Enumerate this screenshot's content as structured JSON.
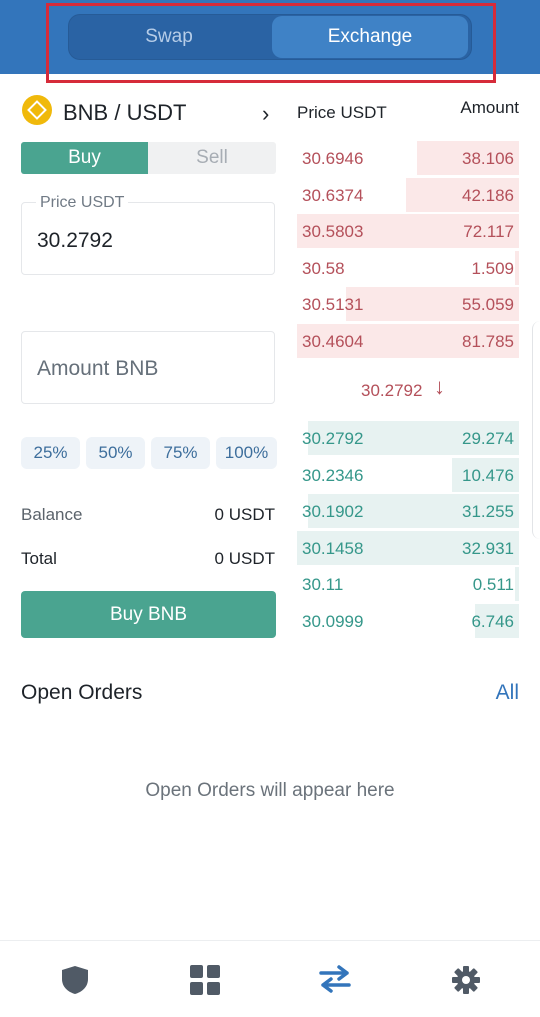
{
  "header": {
    "tabs": [
      "Swap",
      "Exchange"
    ],
    "active_tab": "Exchange"
  },
  "pair": {
    "label": "BNB / USDT",
    "base": "BNB",
    "quote": "USDT",
    "icon": "bnb-coin-icon"
  },
  "side_toggle": {
    "buy": "Buy",
    "sell": "Sell",
    "active": "Buy"
  },
  "price_field": {
    "label": "Price USDT",
    "value": "30.2792"
  },
  "amount_field": {
    "placeholder": "Amount BNB"
  },
  "percent_buttons": [
    "25%",
    "50%",
    "75%",
    "100%"
  ],
  "balance": {
    "label": "Balance",
    "value": "0 USDT"
  },
  "total": {
    "label": "Total",
    "value": "0 USDT"
  },
  "buy_button": "Buy BNB",
  "orderbook": {
    "price_header": "Price USDT",
    "amount_header": "Amount",
    "asks": [
      {
        "price": "30.6946",
        "amount": "38.106",
        "depth": 0.46
      },
      {
        "price": "30.6374",
        "amount": "42.186",
        "depth": 0.51
      },
      {
        "price": "30.5803",
        "amount": "72.117",
        "depth": 1.0
      },
      {
        "price": "30.58",
        "amount": "1.509",
        "depth": 0.02
      },
      {
        "price": "30.5131",
        "amount": "55.059",
        "depth": 0.78
      },
      {
        "price": "30.4604",
        "amount": "81.785",
        "depth": 1.0
      }
    ],
    "last_price": "30.2792",
    "last_direction": "down",
    "bids": [
      {
        "price": "30.2792",
        "amount": "29.274",
        "depth": 0.95
      },
      {
        "price": "30.2346",
        "amount": "10.476",
        "depth": 0.3
      },
      {
        "price": "30.1902",
        "amount": "31.255",
        "depth": 0.95
      },
      {
        "price": "30.1458",
        "amount": "32.931",
        "depth": 1.0
      },
      {
        "price": "30.11",
        "amount": "0.511",
        "depth": 0.02
      },
      {
        "price": "30.0999",
        "amount": "6.746",
        "depth": 0.2
      }
    ]
  },
  "open_orders": {
    "title": "Open Orders",
    "all_link": "All",
    "empty_text": "Open Orders will appear here"
  },
  "tabbar": {
    "items": [
      "shield-icon",
      "grid-icon",
      "swap-arrows-icon",
      "gear-icon"
    ],
    "active": "swap-arrows-icon"
  },
  "colors": {
    "primary": "#3375bb",
    "buy": "#4aa490",
    "ask": "#b4505a",
    "bid": "#35978a",
    "highlight": "#d62b3a"
  }
}
